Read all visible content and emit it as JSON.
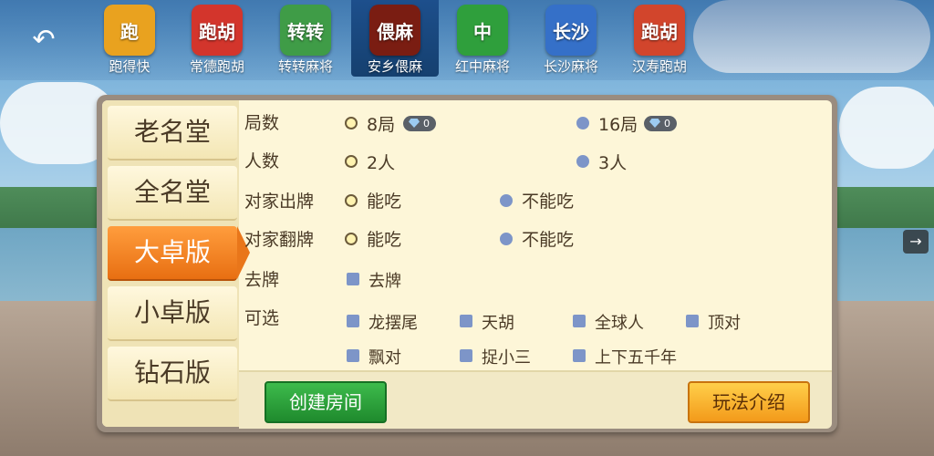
{
  "topbar": {
    "back_icon": "back-arrow-icon",
    "games": [
      {
        "name": "跑得快",
        "glyph": "跑",
        "color": "#e9a21f"
      },
      {
        "name": "常德跑胡",
        "glyph": "跑胡",
        "color": "#d3352c"
      },
      {
        "name": "转转麻将",
        "glyph": "转转",
        "color": "#3f9c47"
      },
      {
        "name": "安乡偎麻",
        "glyph": "偎麻",
        "color": "#7a1d12"
      },
      {
        "name": "红中麻将",
        "glyph": "中",
        "color": "#2f9f3c"
      },
      {
        "name": "长沙麻将",
        "glyph": "长沙",
        "color": "#3570c8"
      },
      {
        "name": "汉寿跑胡",
        "glyph": "跑胡",
        "color": "#d2452c"
      }
    ],
    "active_index": 3
  },
  "sidebar": {
    "items": [
      "老名堂",
      "全名堂",
      "大卓版",
      "小卓版",
      "钻石版"
    ],
    "active_index": 2
  },
  "options": {
    "rounds": {
      "label": "局数",
      "choices": [
        "8局",
        "16局"
      ],
      "costs": [
        "0",
        "0"
      ],
      "selected": "8局"
    },
    "players": {
      "label": "人数",
      "choices": [
        "2人",
        "3人"
      ],
      "selected": "2人"
    },
    "opponent_discard": {
      "label": "对家出牌",
      "choices": [
        "能吃",
        "不能吃"
      ],
      "selected": "能吃"
    },
    "opponent_flip": {
      "label": "对家翻牌",
      "choices": [
        "能吃",
        "不能吃"
      ],
      "selected": "能吃"
    },
    "remove": {
      "label": "去牌",
      "choices": [
        "去牌"
      ]
    },
    "optional": {
      "label": "可选",
      "choices": [
        "龙摆尾",
        "天胡",
        "全球人",
        "顶对",
        "飘对",
        "捉小三",
        "上下五千年"
      ]
    }
  },
  "actions": {
    "create": "创建房间",
    "rules": "玩法介绍"
  },
  "colors": {
    "accent_orange": "#e86f12",
    "create_green": "#1f8a2d",
    "unchecked_blue": "#7d95c8"
  }
}
